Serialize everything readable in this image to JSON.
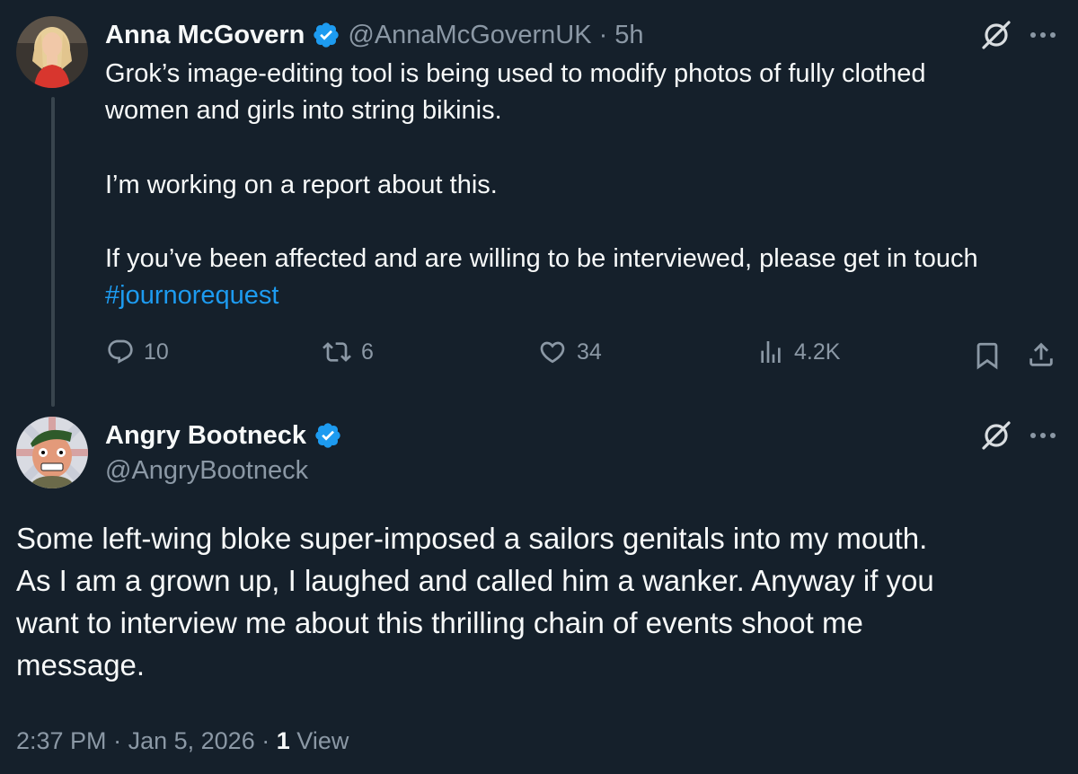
{
  "tweet": {
    "author_name": "Anna McGovern",
    "author_handle": "@AnnaMcGovernUK",
    "time_sep": "·",
    "time_ago": "5h",
    "lines": [
      "Grok’s image-editing tool is being used to modify photos of fully clothed",
      "women and girls into string bikinis.",
      "I’m working on a report about this.",
      "If you’ve been affected and are willing to be interviewed, please get in touch"
    ],
    "hashtag": "#journorequest",
    "stats": {
      "replies": "10",
      "reposts": "6",
      "likes": "34",
      "views": "4.2K"
    }
  },
  "reply": {
    "author_name": "Angry Bootneck",
    "author_handle": "@AngryBootneck",
    "lines": [
      "Some left-wing bloke super-imposed a sailors genitals into my mouth.",
      "As I am a grown up, I laughed and called him a wanker. Anyway if you",
      "want to interview me about this thrilling chain of events shoot me",
      "message."
    ],
    "meta": {
      "time": "2:37 PM",
      "sep1": "·",
      "date": "Jan 5, 2026",
      "sep2": "·",
      "views_count": "1",
      "views_label": "View"
    }
  },
  "colors": {
    "background": "#15202b",
    "text_primary": "#f7f9f9",
    "text_secondary": "#8b98a5",
    "accent": "#1d9bf0",
    "thread_line": "#38444d"
  },
  "icons": {
    "verified": "verified-badge-icon",
    "grok": "grok-icon",
    "more": "more-icon",
    "reply": "reply-icon",
    "repost": "repost-icon",
    "like": "like-icon",
    "views": "views-icon",
    "bookmark": "bookmark-icon",
    "share": "share-icon"
  }
}
